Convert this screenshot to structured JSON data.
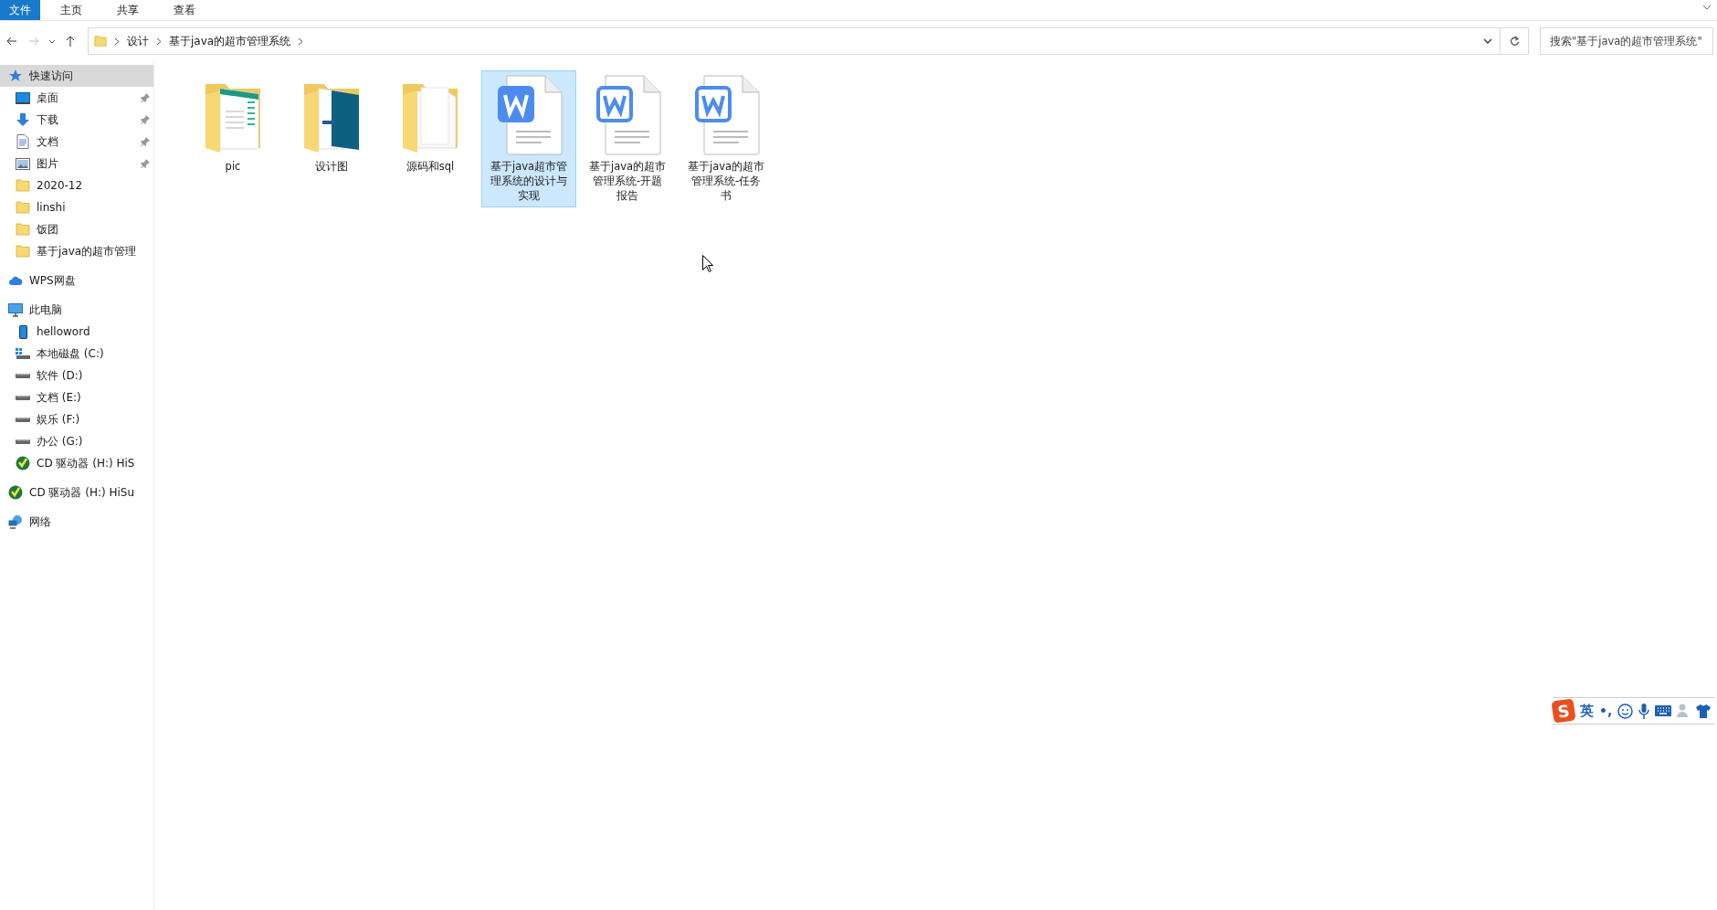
{
  "ribbon": {
    "tabs": [
      {
        "label": "文件",
        "selected": true
      },
      {
        "label": "主页",
        "selected": false
      },
      {
        "label": "共享",
        "selected": false
      },
      {
        "label": "查看",
        "selected": false
      }
    ]
  },
  "address": {
    "crumbs": [
      "设计",
      "基于java的超市管理系统"
    ],
    "search_placeholder": "搜索\"基于java的超市管理系统\""
  },
  "sidebar": {
    "items": [
      {
        "label": "快速访问",
        "kind": "quick",
        "selected": true,
        "children": [
          {
            "label": "桌面",
            "kind": "desktop",
            "pinned": true
          },
          {
            "label": "下载",
            "kind": "download",
            "pinned": true
          },
          {
            "label": "文档",
            "kind": "docs",
            "pinned": true
          },
          {
            "label": "图片",
            "kind": "pictures",
            "pinned": true
          },
          {
            "label": "2020-12",
            "kind": "folder",
            "pinned": false
          },
          {
            "label": "linshi",
            "kind": "folder",
            "pinned": false
          },
          {
            "label": "饭团",
            "kind": "folder",
            "pinned": false
          },
          {
            "label": "基于java的超市管理",
            "kind": "folder",
            "pinned": false
          }
        ]
      },
      {
        "label": "WPS网盘",
        "kind": "cloud",
        "selected": false
      },
      {
        "label": "此电脑",
        "kind": "pc",
        "selected": false,
        "children": [
          {
            "label": "helloword",
            "kind": "phone",
            "pinned": false
          },
          {
            "label": "本地磁盘 (C:)",
            "kind": "system-drive",
            "pinned": false
          },
          {
            "label": "软件 (D:)",
            "kind": "drive",
            "pinned": false
          },
          {
            "label": "文档 (E:)",
            "kind": "drive",
            "pinned": false
          },
          {
            "label": "娱乐 (F:)",
            "kind": "drive",
            "pinned": false
          },
          {
            "label": "办公 (G:)",
            "kind": "drive",
            "pinned": false
          },
          {
            "label": "CD 驱动器 (H:) HiS",
            "kind": "cd",
            "pinned": false
          }
        ]
      },
      {
        "label": "CD 驱动器 (H:) HiSu",
        "kind": "cd",
        "selected": false
      },
      {
        "label": "网络",
        "kind": "network",
        "selected": false
      }
    ]
  },
  "files": [
    {
      "name": "pic",
      "kind": "folder-green",
      "selected": false
    },
    {
      "name": "设计图",
      "kind": "folder-blue",
      "selected": false
    },
    {
      "name": "源码和sql",
      "kind": "folder-plain",
      "selected": false
    },
    {
      "name": "基于java超市管理系统的设计与实现",
      "kind": "doc-filled",
      "selected": true
    },
    {
      "name": "基于java的超市管理系统-开题报告",
      "kind": "doc-outline",
      "selected": false
    },
    {
      "name": "基于java的超市管理系统-任务书",
      "kind": "doc-outline",
      "selected": false
    }
  ],
  "ime": {
    "logo": "S",
    "mode": "英",
    "punct": "•,"
  }
}
